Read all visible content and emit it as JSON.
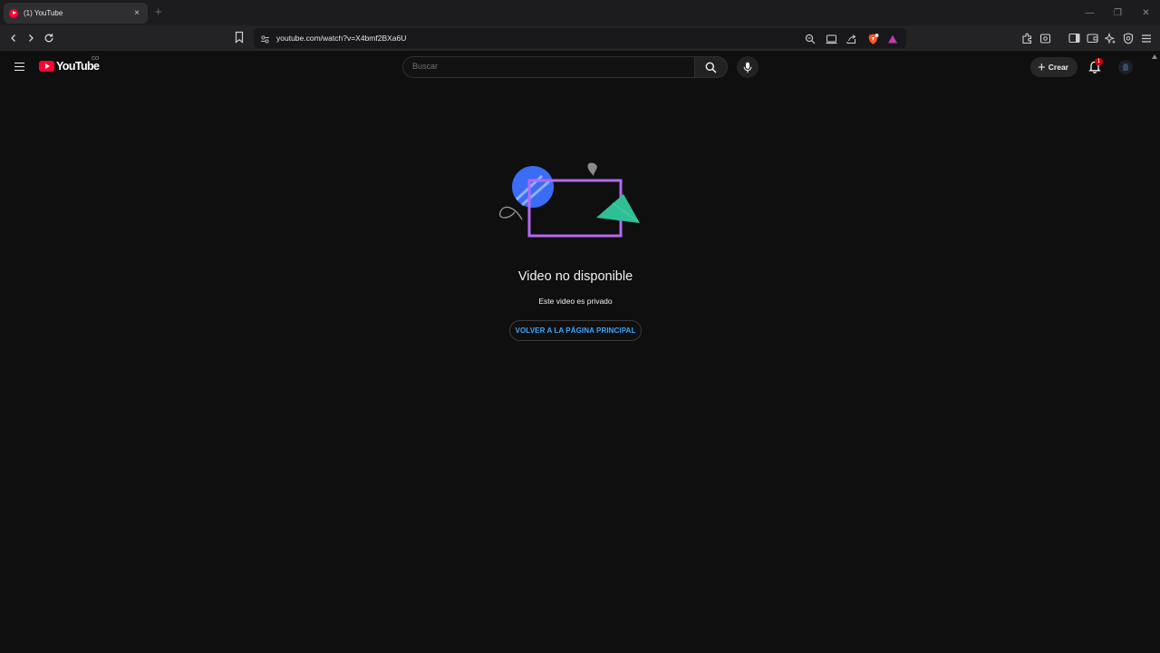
{
  "browser": {
    "tab_title": "(1) YouTube",
    "tab_close": "×",
    "new_tab": "+",
    "url": "youtube.com/watch?v=X4bmf2BXa6U",
    "window_controls": [
      "—",
      "❐",
      "✕"
    ]
  },
  "masthead": {
    "logo_text": "YouTube",
    "country_code": "CO",
    "search_placeholder": "Buscar",
    "create_label": "Crear",
    "notification_count": "1"
  },
  "content": {
    "title": "Video no disponible",
    "subtitle": "Este video es privado",
    "home_button": "VOLVER A LA PÁGINA PRINCIPAL"
  },
  "colors": {
    "background": "#0f0f0f",
    "brand_red": "#ff0033",
    "link_blue": "#3ea6ff"
  }
}
